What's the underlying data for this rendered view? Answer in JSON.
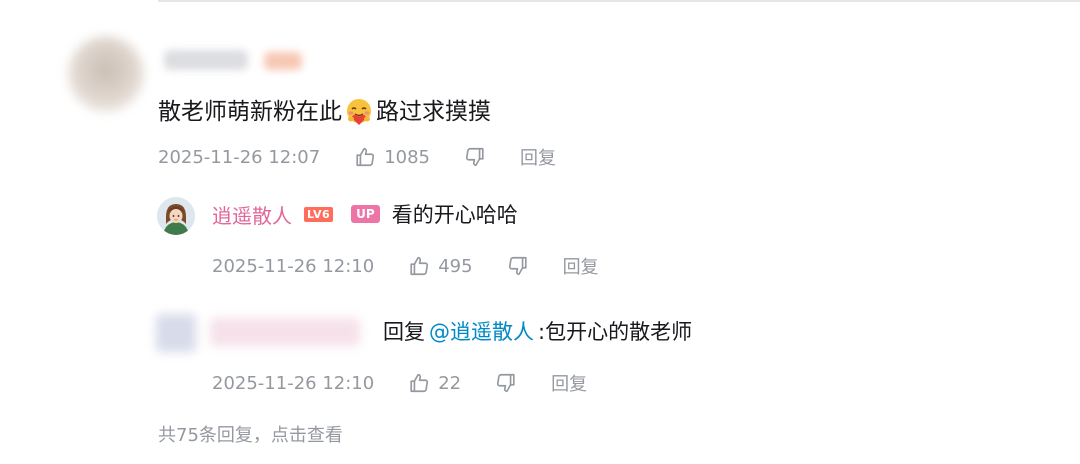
{
  "main_comment": {
    "content_before": "散老师萌新粉在此",
    "emoji": "hug-heart-emoji",
    "content_after": "路过求摸摸",
    "time": "2025-11-26 12:07",
    "likes": "1085",
    "reply_label": "回复"
  },
  "reply1": {
    "username": "逍遥散人",
    "level_badge": "LV6",
    "up_badge": "UP",
    "content": "看的开心哈哈",
    "time": "2025-11-26 12:10",
    "likes": "495",
    "reply_label": "回复",
    "username_color": "#e1679a"
  },
  "reply2": {
    "prefix": "回复",
    "mention": "@逍遥散人",
    "content": ":包开心的散老师",
    "time": "2025-11-26 12:10",
    "likes": "22",
    "reply_label": "回复",
    "mention_color": "#008ac5"
  },
  "footer": {
    "more_replies": "共75条回复，点击查看"
  },
  "colors": {
    "meta_gray": "#9499a0",
    "text": "#18191c"
  }
}
